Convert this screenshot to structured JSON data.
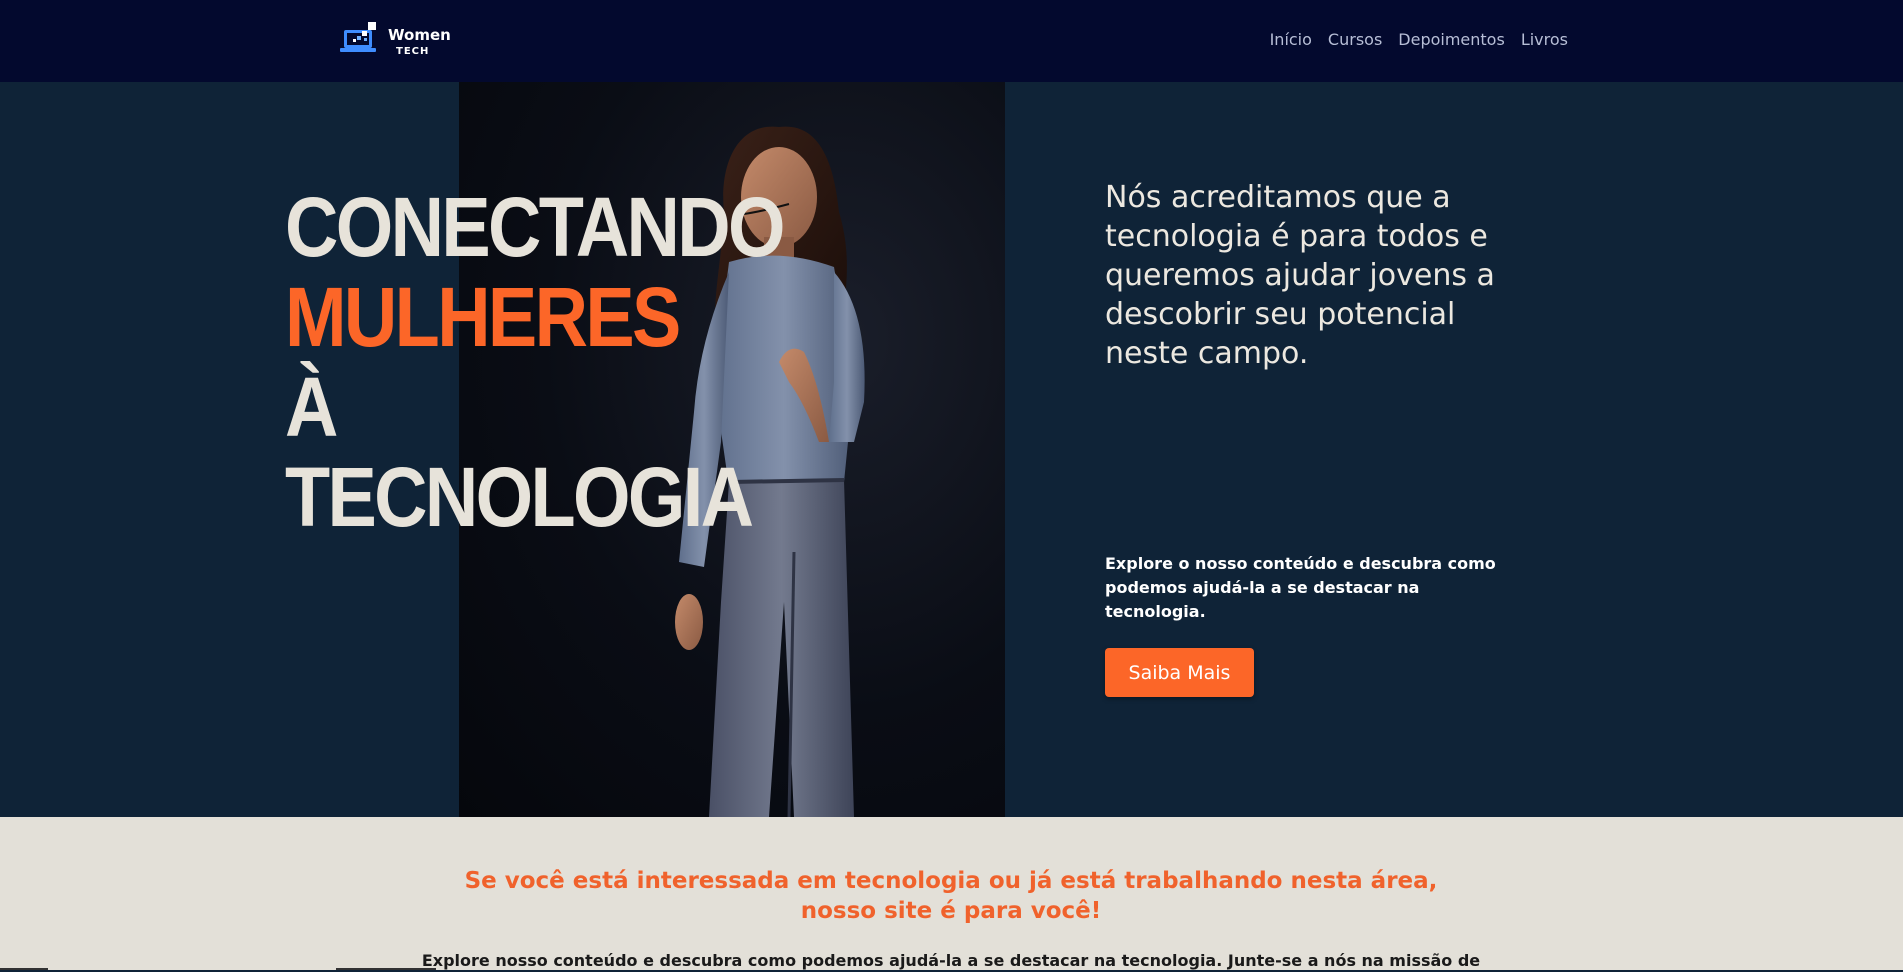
{
  "header": {
    "logo": {
      "line1": "Women",
      "line2": "TECH",
      "icon": "laptop-pixel-icon"
    },
    "nav": [
      {
        "label": "Início"
      },
      {
        "label": "Cursos"
      },
      {
        "label": "Depoimentos"
      },
      {
        "label": "Livros"
      }
    ]
  },
  "hero": {
    "headline_line1": "CONECTANDO",
    "headline_accent": "MULHERES",
    "headline_rest": " À",
    "headline_line3": "TECNOLOGIA",
    "tagline": "Nós acreditamos que a tecnologia é para todos e queremos ajudar jovens a descobrir seu potencial neste campo.",
    "subtext": "Explore o nosso conteúdo e descubra como podemos ajudá-la a se destacar na tecnologia.",
    "cta_label": "Saiba Mais",
    "photo": "woman-speaker-photo"
  },
  "intro": {
    "title": "Se você está interessada em tecnologia ou já está trabalhando nesta área, nosso site é para você!",
    "text": "Explore nosso conteúdo e descubra como podemos ajudá-la a se destacar na tecnologia. Junte-se a nós na missão de"
  },
  "colors": {
    "navbar": "#03092e",
    "hero_bg": "#0f2337",
    "accent": "#fc6628",
    "section_bg": "#e3e0d8"
  }
}
